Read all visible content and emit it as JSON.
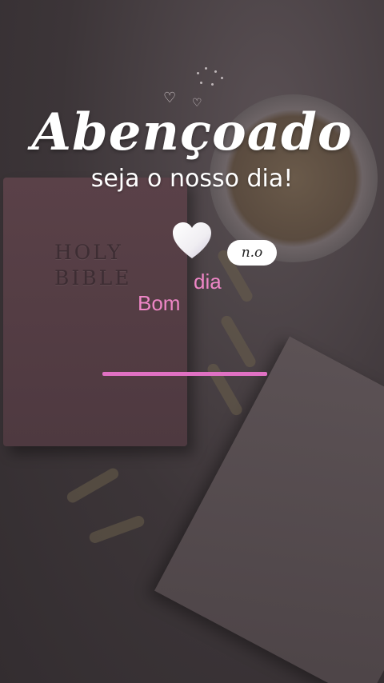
{
  "background": {
    "scene": "bible-coffee-notebook",
    "colors": {
      "overlay": "#3a3336",
      "accent": "#ee86c6",
      "bar": "#e071c3"
    }
  },
  "bible": {
    "cover_line1": "HOLY",
    "cover_line2": "BIBLE"
  },
  "headline": {
    "title": "Abençoado",
    "subtitle": "seja o nosso dia!"
  },
  "decor": {
    "heart_icon": "white-heart-emoji",
    "small_hearts": [
      "heart-outline-icon",
      "heart-outline-icon"
    ]
  },
  "badge": {
    "label": "n.o"
  },
  "greeting": {
    "word1": "Bom",
    "word2": "dia"
  }
}
